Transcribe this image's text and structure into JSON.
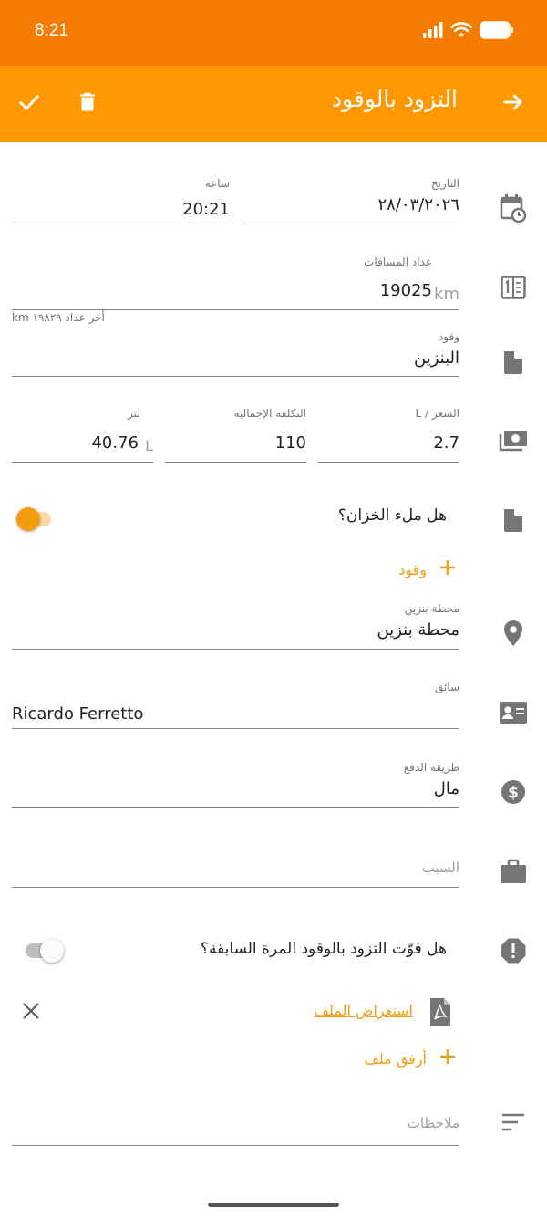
{
  "status_bar": {
    "time": "8:21"
  },
  "app_bar": {
    "title": "التزود بالوقود"
  },
  "date_time": {
    "date_label": "التاريخ",
    "date_value": "٢٨/٠٣/٢٠٢٦",
    "time_label": "ساعة",
    "time_value": "20:21"
  },
  "odometer": {
    "label": "عداد المسافات",
    "value": "19025",
    "unit": "km",
    "helper": "أخر عداد ١٩٨٢٩ km"
  },
  "fuel": {
    "label": "وقود",
    "value": "البنزين"
  },
  "pricing": {
    "price_label": "السعر / L",
    "price_value": "2.7",
    "total_label": "التكلفة الإجمالية",
    "total_value": "110",
    "liters_label": "لتر",
    "liters_value": "40.76",
    "liters_unit": "L"
  },
  "full_tank": {
    "label": "هل ملء الخزان؟",
    "checked": true
  },
  "add_fuel": {
    "label": "وقود",
    "icon": "plus-icon"
  },
  "station": {
    "label": "محطة بنزين",
    "value": "محطة بنزين"
  },
  "driver": {
    "label": "سائق",
    "value": "Ricardo Ferretto"
  },
  "payment": {
    "label": "طريقة الدفع",
    "value": "مال"
  },
  "reason": {
    "placeholder": "السبب"
  },
  "missed_previous": {
    "label": "هل فوّت التزود بالوقود المرة السابقة؟",
    "checked": false
  },
  "attachment": {
    "view_label": "استعراض الملف",
    "add_label": "أرفق ملف"
  },
  "notes": {
    "placeholder": "ملاحظات"
  },
  "colors": {
    "status_bar": "#f57c00",
    "app_bar": "#ff9800",
    "accent": "#f39c12",
    "icon_gray": "#757575"
  }
}
